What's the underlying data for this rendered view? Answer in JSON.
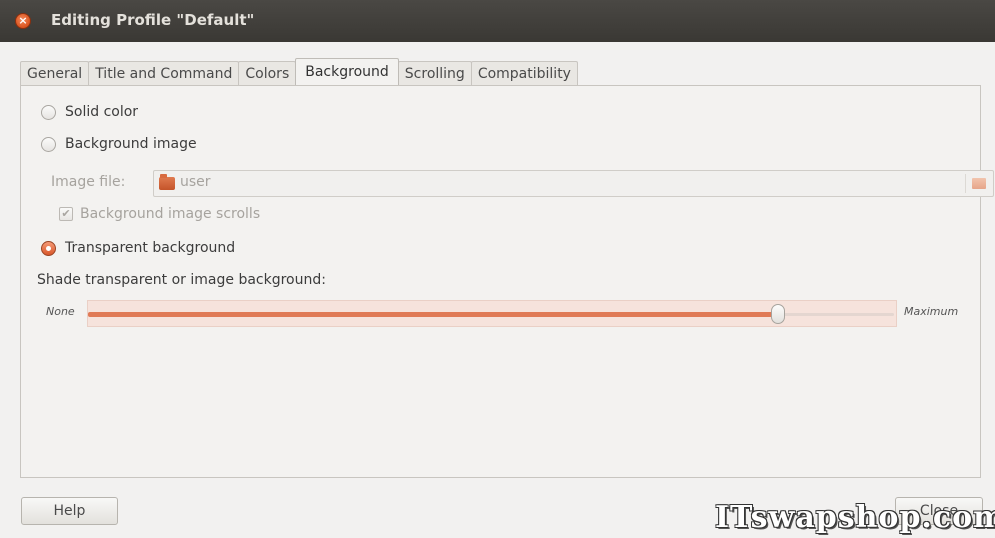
{
  "window": {
    "title": "Editing Profile \"Default\"",
    "close_glyph": "×"
  },
  "tabs": [
    {
      "label": "General"
    },
    {
      "label": "Title and Command"
    },
    {
      "label": "Colors"
    },
    {
      "label": "Background",
      "active": true
    },
    {
      "label": "Scrolling"
    },
    {
      "label": "Compatibility"
    }
  ],
  "background": {
    "solid_color_label": "Solid color",
    "background_image_label": "Background image",
    "image_file_label": "Image file:",
    "image_file_value": "user",
    "image_scrolls_label": "Background image scrolls",
    "image_scrolls_checked": true,
    "transparent_label": "Transparent background",
    "selected_option": "Transparent background",
    "shade_label": "Shade transparent or image background:",
    "slider_min_label": "None",
    "slider_max_label": "Maximum",
    "shade_level": 0.86
  },
  "buttons": {
    "help": "Help",
    "close": "Close"
  },
  "watermark": "ITswapshop.com",
  "colors": {
    "accent": "#dd4814",
    "titlebar": "#3c3b37",
    "panel": "#f2f1f0"
  },
  "icons": {
    "close": "close-icon",
    "folder": "folder-icon",
    "file_chooser": "folder-open-icon",
    "checkmark": "checkmark-icon"
  }
}
